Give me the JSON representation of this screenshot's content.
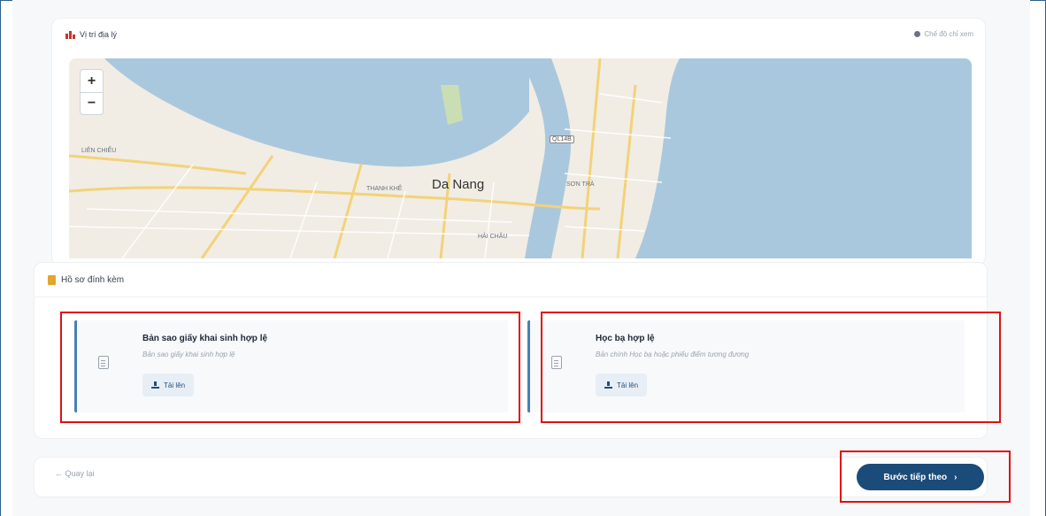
{
  "location": {
    "title": "Vị trí địa lý",
    "hint": "Chế độ chỉ xem"
  },
  "map": {
    "zoom_in": "+",
    "zoom_out": "−",
    "labels": {
      "city": "Da Nang",
      "lien_chieu": "LIÊN CHIỂU",
      "thanh_khe": "THANH KHÊ",
      "son_tra": "SƠN TRÀ",
      "hai_chau": "HẢI CHÂU",
      "road": "QL14B"
    }
  },
  "attachments": {
    "title": "Hồ sơ đính kèm",
    "items": [
      {
        "name": "Bản sao giấy khai sinh hợp lệ",
        "desc": "Bản sao giấy khai sinh hợp lệ",
        "upload_label": "Tải lên"
      },
      {
        "name": "Học bạ hợp lệ",
        "desc": "Bản chính Học bạ hoặc phiếu điểm tương đương",
        "upload_label": "Tải lên"
      }
    ]
  },
  "footer": {
    "back_label": "← Quay lại",
    "next_label": "Bước tiếp theo",
    "next_arrow": "›"
  },
  "colors": {
    "primary": "#1b4b79",
    "highlight": "#e01010",
    "card_accent": "#4a7fb5",
    "water": "#aac8dd",
    "land": "#f1ede4"
  }
}
